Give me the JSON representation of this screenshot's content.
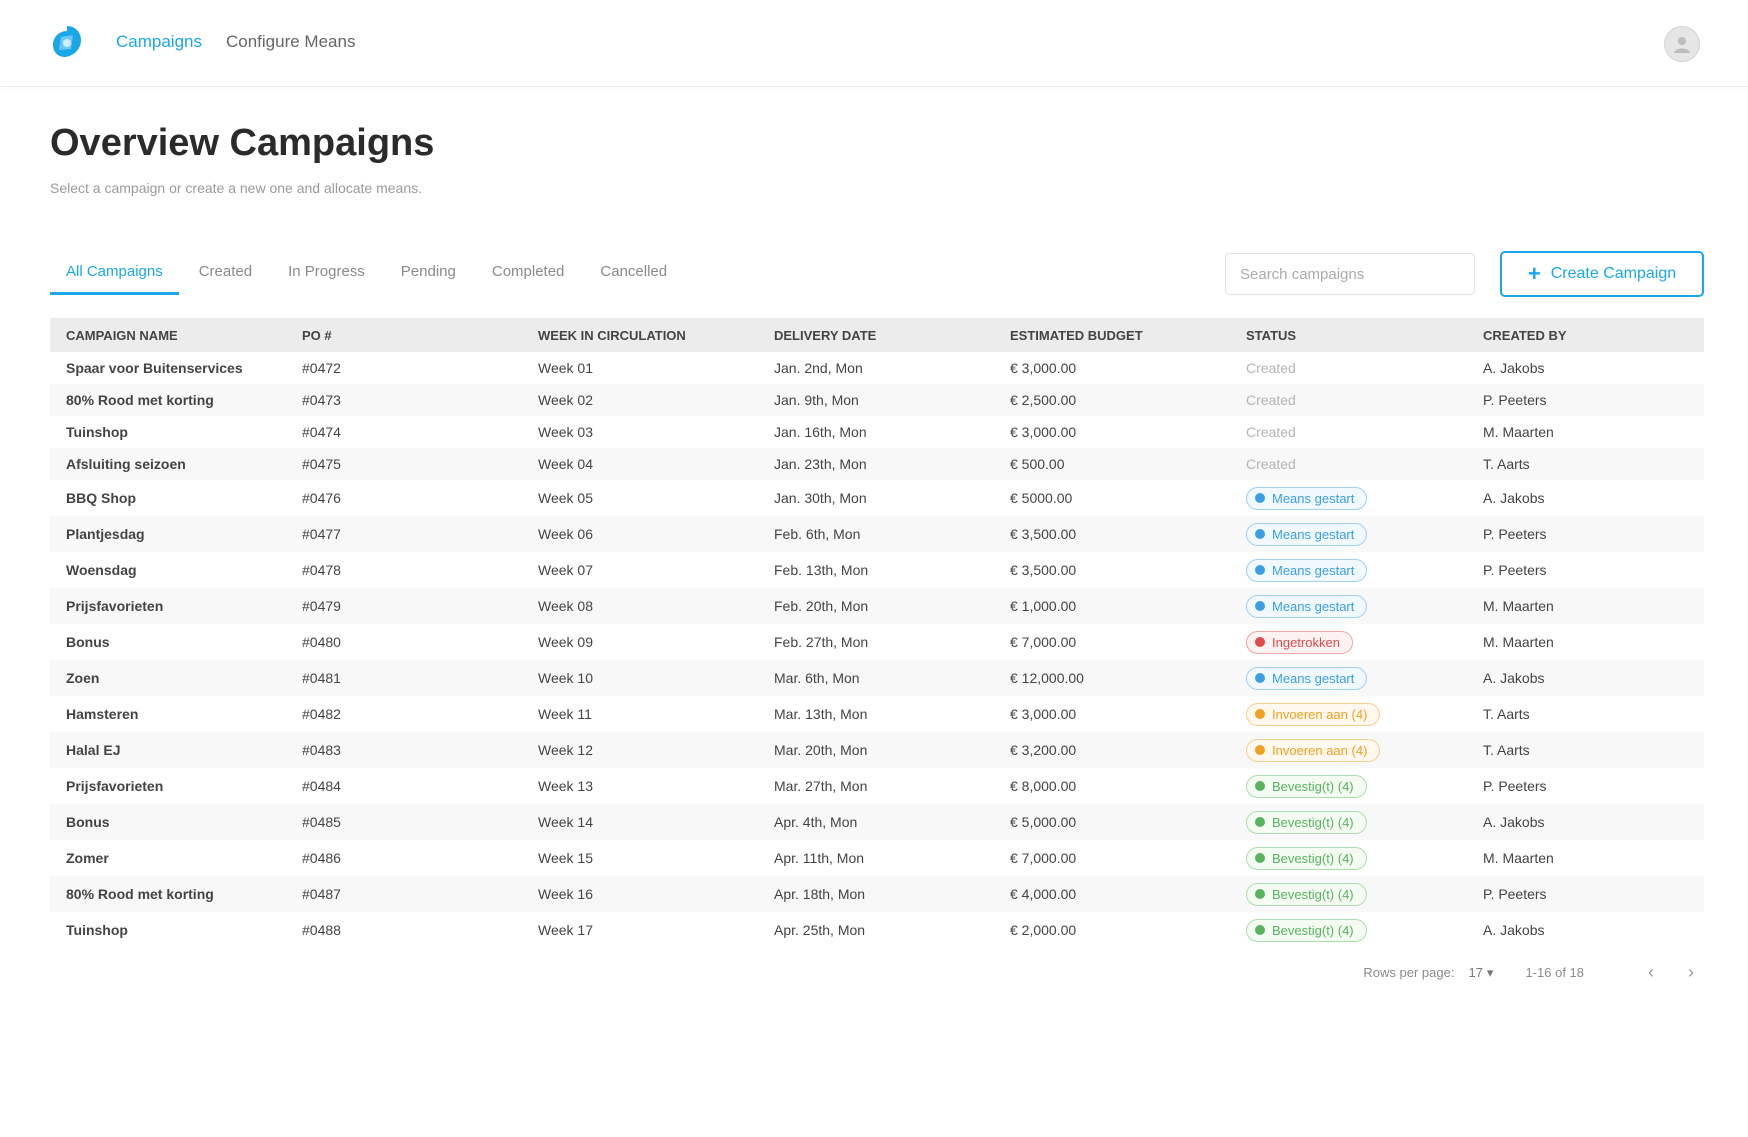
{
  "brand": {
    "accent": "#1aa7e8"
  },
  "nav": {
    "items": [
      "Campaigns",
      "Configure Means"
    ]
  },
  "header": {
    "title": "Overview Campaigns",
    "subtitle": "Select a campaign or create a new one and allocate means."
  },
  "tabs": [
    "All Campaigns",
    "Created",
    "In Progress",
    "Pending",
    "Completed",
    "Cancelled"
  ],
  "search": {
    "placeholder": "Search campaigns",
    "value": ""
  },
  "create_button": {
    "label": "Create Campaign",
    "icon": "plus-icon"
  },
  "table": {
    "columns": [
      "Campaign Name",
      "PO #",
      "Week in Circulation",
      "Delivery Date",
      "Estimated Budget",
      "Status",
      "Created By"
    ],
    "rows": [
      {
        "name": "Spaar voor Buitenservices",
        "po": "#0472",
        "week": "Week 01",
        "date": "Jan. 2nd, Mon",
        "budget": "€ 3,000.00",
        "status": "Created",
        "status_kind": "plain",
        "by": "A. Jakobs"
      },
      {
        "name": "80% Rood met korting",
        "po": "#0473",
        "week": "Week 02",
        "date": "Jan. 9th, Mon",
        "budget": "€ 2,500.00",
        "status": "Created",
        "status_kind": "plain",
        "by": "P. Peeters"
      },
      {
        "name": "Tuinshop",
        "po": "#0474",
        "week": "Week 03",
        "date": "Jan. 16th, Mon",
        "budget": "€ 3,000.00",
        "status": "Created",
        "status_kind": "plain",
        "by": "M. Maarten"
      },
      {
        "name": "Afsluiting seizoen",
        "po": "#0475",
        "week": "Week 04",
        "date": "Jan. 23th, Mon",
        "budget": "€ 500.00",
        "status": "Created",
        "status_kind": "plain",
        "by": "T. Aarts"
      },
      {
        "name": "BBQ Shop",
        "po": "#0476",
        "week": "Week 05",
        "date": "Jan. 30th, Mon",
        "budget": "€ 5000.00",
        "status": "Means gestart",
        "status_kind": "blue",
        "by": "A. Jakobs"
      },
      {
        "name": "Plantjesdag",
        "po": "#0477",
        "week": "Week 06",
        "date": "Feb. 6th, Mon",
        "budget": "€ 3,500.00",
        "status": "Means gestart",
        "status_kind": "blue",
        "by": "P. Peeters"
      },
      {
        "name": "Woensdag",
        "po": "#0478",
        "week": "Week 07",
        "date": "Feb. 13th, Mon",
        "budget": "€ 3,500.00",
        "status": "Means gestart",
        "status_kind": "blue",
        "by": "P. Peeters"
      },
      {
        "name": "Prijsfavorieten",
        "po": "#0479",
        "week": "Week 08",
        "date": "Feb. 20th, Mon",
        "budget": "€ 1,000.00",
        "status": "Means gestart",
        "status_kind": "blue",
        "by": "M. Maarten"
      },
      {
        "name": "Bonus",
        "po": "#0480",
        "week": "Week 09",
        "date": "Feb. 27th, Mon",
        "budget": "€ 7,000.00",
        "status": "Ingetrokken",
        "status_kind": "red",
        "by": "M. Maarten"
      },
      {
        "name": "Zoen",
        "po": "#0481",
        "week": "Week 10",
        "date": "Mar. 6th, Mon",
        "budget": "€ 12,000.00",
        "status": "Means gestart",
        "status_kind": "blue",
        "by": "A. Jakobs"
      },
      {
        "name": "Hamsteren",
        "po": "#0482",
        "week": "Week 11",
        "date": "Mar. 13th, Mon",
        "budget": "€ 3,000.00",
        "status": "Invoeren aan (4)",
        "status_kind": "orange",
        "by": "T. Aarts"
      },
      {
        "name": "Halal EJ",
        "po": "#0483",
        "week": "Week 12",
        "date": "Mar. 20th, Mon",
        "budget": "€ 3,200.00",
        "status": "Invoeren aan (4)",
        "status_kind": "orange",
        "by": "T. Aarts"
      },
      {
        "name": "Prijsfavorieten",
        "po": "#0484",
        "week": "Week 13",
        "date": "Mar. 27th, Mon",
        "budget": "€ 8,000.00",
        "status": "Bevestig(t) (4)",
        "status_kind": "green",
        "by": "P. Peeters"
      },
      {
        "name": "Bonus",
        "po": "#0485",
        "week": "Week 14",
        "date": "Apr. 4th, Mon",
        "budget": "€ 5,000.00",
        "status": "Bevestig(t) (4)",
        "status_kind": "green",
        "by": "A. Jakobs"
      },
      {
        "name": "Zomer",
        "po": "#0486",
        "week": "Week 15",
        "date": "Apr. 11th, Mon",
        "budget": "€ 7,000.00",
        "status": "Bevestig(t) (4)",
        "status_kind": "green",
        "by": "M. Maarten"
      },
      {
        "name": "80% Rood met korting",
        "po": "#0487",
        "week": "Week 16",
        "date": "Apr. 18th, Mon",
        "budget": "€ 4,000.00",
        "status": "Bevestig(t) (4)",
        "status_kind": "green",
        "by": "P. Peeters"
      },
      {
        "name": "Tuinshop",
        "po": "#0488",
        "week": "Week 17",
        "date": "Apr. 25th, Mon",
        "budget": "€ 2,000.00",
        "status": "Bevestig(t) (4)",
        "status_kind": "green",
        "by": "A. Jakobs"
      }
    ]
  },
  "pagination": {
    "rows_label": "Rows per page:",
    "rows_value": "17",
    "range": "1-16 of 18"
  }
}
